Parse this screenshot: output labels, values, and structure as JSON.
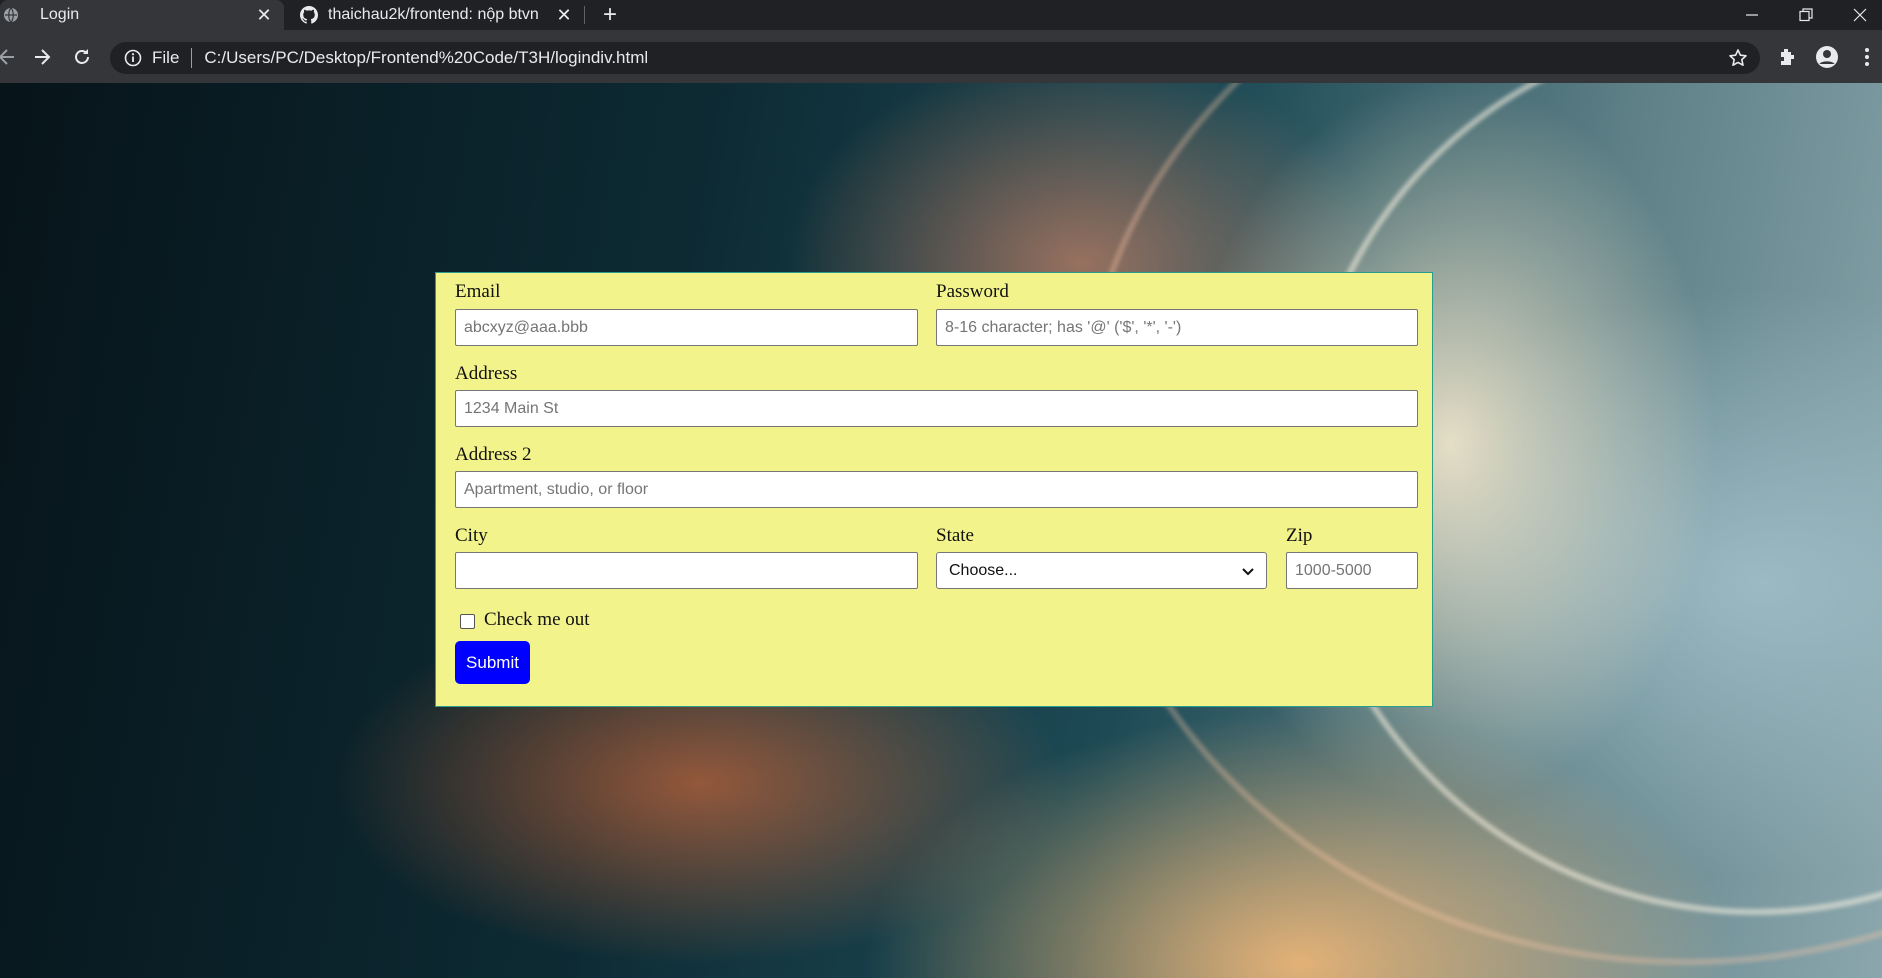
{
  "browser": {
    "tabs": [
      {
        "title": "Login",
        "active": true
      },
      {
        "title": "thaichau2k/frontend: nộp btvn",
        "active": false
      }
    ],
    "address": {
      "scheme": "File",
      "url": "C:/Users/PC/Desktop/Frontend%20Code/T3H/logindiv.html"
    }
  },
  "form": {
    "email": {
      "label": "Email",
      "placeholder": "abcxyz@aaa.bbb"
    },
    "password": {
      "label": "Password",
      "placeholder": "8-16 character; has '@' ('$', '*', '-')"
    },
    "address": {
      "label": "Address",
      "placeholder": "1234 Main St"
    },
    "address2": {
      "label": "Address 2",
      "placeholder": "Apartment, studio, or floor"
    },
    "city": {
      "label": "City",
      "value": ""
    },
    "state": {
      "label": "State",
      "selected": "Choose..."
    },
    "zip": {
      "label": "Zip",
      "placeholder": "1000-5000"
    },
    "checkbox": {
      "label": "Check me out",
      "checked": false
    },
    "submit_label": "Submit"
  },
  "colors": {
    "form_background": "#f3f38b",
    "form_border": "#2a9d8f",
    "submit_background": "#0000ff"
  }
}
